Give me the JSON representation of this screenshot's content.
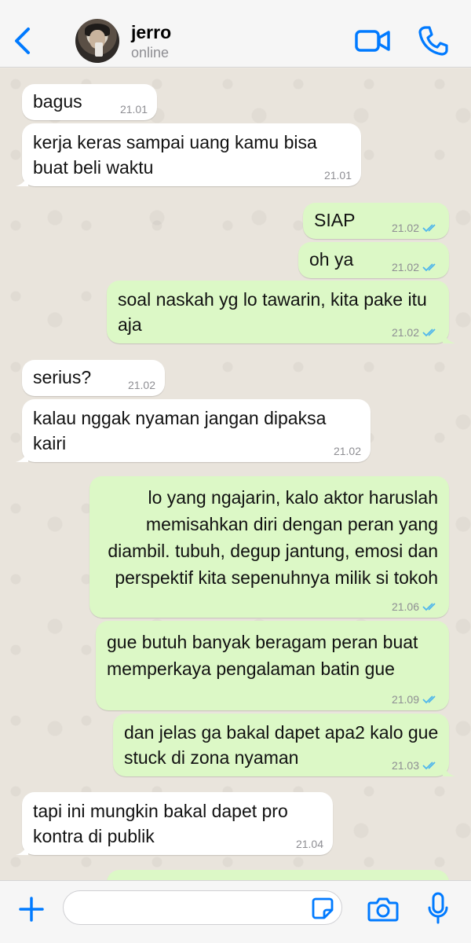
{
  "header": {
    "contact_name": "jerro",
    "status": "online",
    "back_icon": "chevron-left-icon",
    "video_icon": "video-camera-icon",
    "call_icon": "phone-icon",
    "accent_color": "#007aff"
  },
  "messages": [
    {
      "dir": "in",
      "text": "bagus",
      "time": "21.01"
    },
    {
      "dir": "in",
      "text": "kerja keras sampai uang kamu bisa buat beli waktu",
      "time": "21.01"
    },
    {
      "dir": "out",
      "text": "SIAP",
      "time": "21.02",
      "read": true
    },
    {
      "dir": "out",
      "text": "oh ya",
      "time": "21.02",
      "read": true
    },
    {
      "dir": "out",
      "text": "soal naskah yg lo tawarin, kita pake itu aja",
      "time": "21.02",
      "read": true
    },
    {
      "dir": "in",
      "text": "serius?",
      "time": "21.02"
    },
    {
      "dir": "in",
      "text": "kalau nggak nyaman jangan dipaksa kairi",
      "time": "21.02"
    },
    {
      "dir": "out",
      "text": "lo yang ngajarin, kalo aktor haruslah memisahkan diri dengan peran yang diambil. tubuh, degup jantung, emosi dan perspektif kita sepenuhnya milik si tokoh",
      "time": "21.06",
      "read": true
    },
    {
      "dir": "out",
      "text": "gue butuh banyak beragam peran buat memperkaya pengalaman batin gue",
      "time": "21.09",
      "read": true
    },
    {
      "dir": "out",
      "text": "dan jelas ga bakal dapet apa2 kalo gue stuck di zona nyaman",
      "time": "21.03",
      "read": true
    },
    {
      "dir": "in",
      "text": "tapi ini mungkin bakal dapet pro kontra di publik",
      "time": "21.04"
    }
  ],
  "composer": {
    "input_value": "",
    "input_placeholder": "",
    "icons": [
      "plus-icon",
      "sticker-icon",
      "camera-icon",
      "microphone-icon"
    ]
  },
  "colors": {
    "incoming_bubble": "#ffffff",
    "outgoing_bubble": "#dcf8c6",
    "read_ticks": "#4fb6ec",
    "chat_background": "#e9e4dc"
  }
}
